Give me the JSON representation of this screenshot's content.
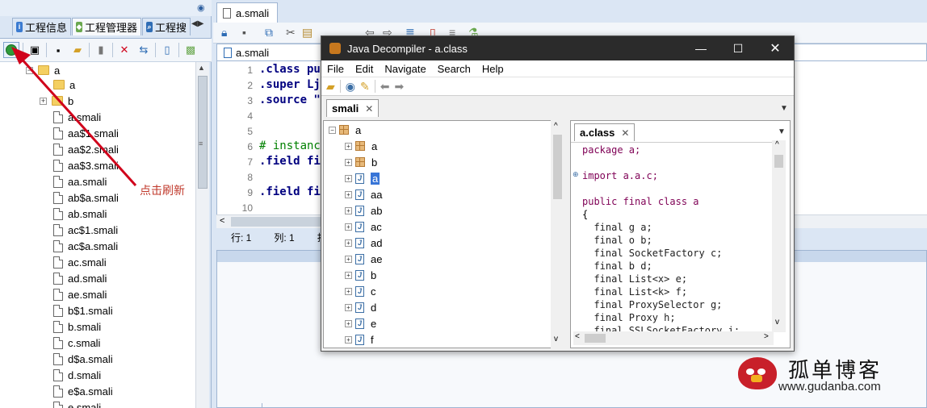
{
  "left_panel": {
    "tabs": [
      {
        "label": "工程信息",
        "icon": "info-icon"
      },
      {
        "label": "工程管理器",
        "icon": "android-icon"
      },
      {
        "label": "工程搜",
        "icon": "search-icon"
      }
    ],
    "tree": {
      "root": "a",
      "folders": [
        "a",
        "b"
      ],
      "files": [
        "a.smali",
        "aa$1.smali",
        "aa$2.smali",
        "aa$3.smali",
        "aa.smali",
        "ab$a.smali",
        "ab.smali",
        "ac$1.smali",
        "ac$a.smali",
        "ac.smali",
        "ad.smali",
        "ae.smali",
        "b$1.smali",
        "b.smali",
        "c.smali",
        "d$a.smali",
        "d.smali",
        "e$a.smali",
        "e.smali"
      ]
    }
  },
  "editor": {
    "tab_label": "a.smali",
    "path_label": "a.smali",
    "lines": [
      {
        "n": "1",
        "text": ".class pu"
      },
      {
        "n": "2",
        "text": ".super Lj"
      },
      {
        "n": "3",
        "text": ".source \""
      },
      {
        "n": "4",
        "text": ""
      },
      {
        "n": "5",
        "text": ""
      },
      {
        "n": "6",
        "text": "# instanc"
      },
      {
        "n": "7",
        "text": ".field fi"
      },
      {
        "n": "8",
        "text": ""
      },
      {
        "n": "9",
        "text": ".field fi"
      },
      {
        "n": "10",
        "text": ""
      }
    ],
    "status": {
      "row": "行: 1",
      "col": "列: 1",
      "extra": "排"
    }
  },
  "decompiler": {
    "title": "Java Decompiler - a.class",
    "menu": [
      "File",
      "Edit",
      "Navigate",
      "Search",
      "Help"
    ],
    "outer_tab": "smali",
    "inner_tab": "a.class",
    "tree_root": "a",
    "tree_packages": [
      "a",
      "b"
    ],
    "tree_classes": [
      "a",
      "aa",
      "ab",
      "ac",
      "ad",
      "ae",
      "b",
      "c",
      "d",
      "e",
      "f"
    ],
    "code": [
      "package a;",
      "",
      "import a.a.c;",
      "",
      "public final class a",
      "{",
      "  final g a;",
      "  final o b;",
      "  final SocketFactory c;",
      "  final b d;",
      "  final List<x> e;",
      "  final List<k> f;",
      "  final ProxySelector g;",
      "  final Proxy h;",
      "  final SSLSocketFactory i;"
    ]
  },
  "annotation": {
    "text": "点击刷新",
    "color": "#c0392b"
  },
  "watermark": {
    "title": "孤单博客",
    "url": "www.gudanba.com"
  }
}
